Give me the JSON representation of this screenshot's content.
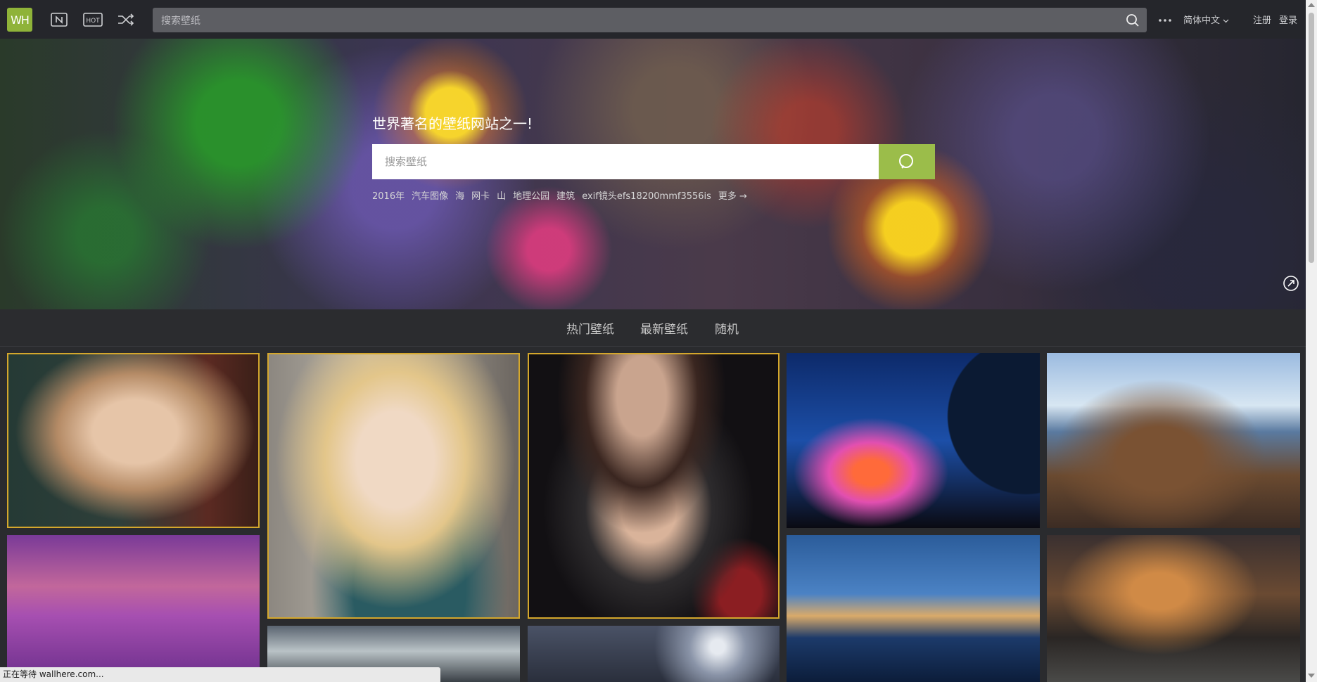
{
  "header": {
    "logo_text": "WH",
    "search_placeholder": "搜索壁纸",
    "language": "简体中文",
    "register": "注册",
    "login": "登录"
  },
  "hero": {
    "title": "世界著名的壁纸网站之一!",
    "search_placeholder": "搜索壁纸",
    "tags": [
      "2016年",
      "汽车图像",
      "海",
      "网卡",
      "山",
      "地理公园",
      "建筑",
      "exif镜头efs18200mmf3556is",
      "更多 →"
    ]
  },
  "tabs": [
    "热门壁纸",
    "最新壁纸",
    "随机"
  ],
  "wallpapers": [
    {
      "label": "portrait-woman-room"
    },
    {
      "label": "anime-blonde-girl"
    },
    {
      "label": "woman-black-outfit"
    },
    {
      "label": "space-nebula-planet"
    },
    {
      "label": "anime-city-fantasy"
    },
    {
      "label": "purple-lake-sunset"
    },
    {
      "label": "blue-lake-dusk"
    },
    {
      "label": "autumn-road-curve"
    },
    {
      "label": "stormy-sky"
    },
    {
      "label": "night-moon-sky"
    }
  ],
  "status_bar": "正在等待 wallhere.com...",
  "colors": {
    "accent": "#9bbd4a",
    "selected_border": "#d4a72c",
    "topbar": "#25262b"
  }
}
